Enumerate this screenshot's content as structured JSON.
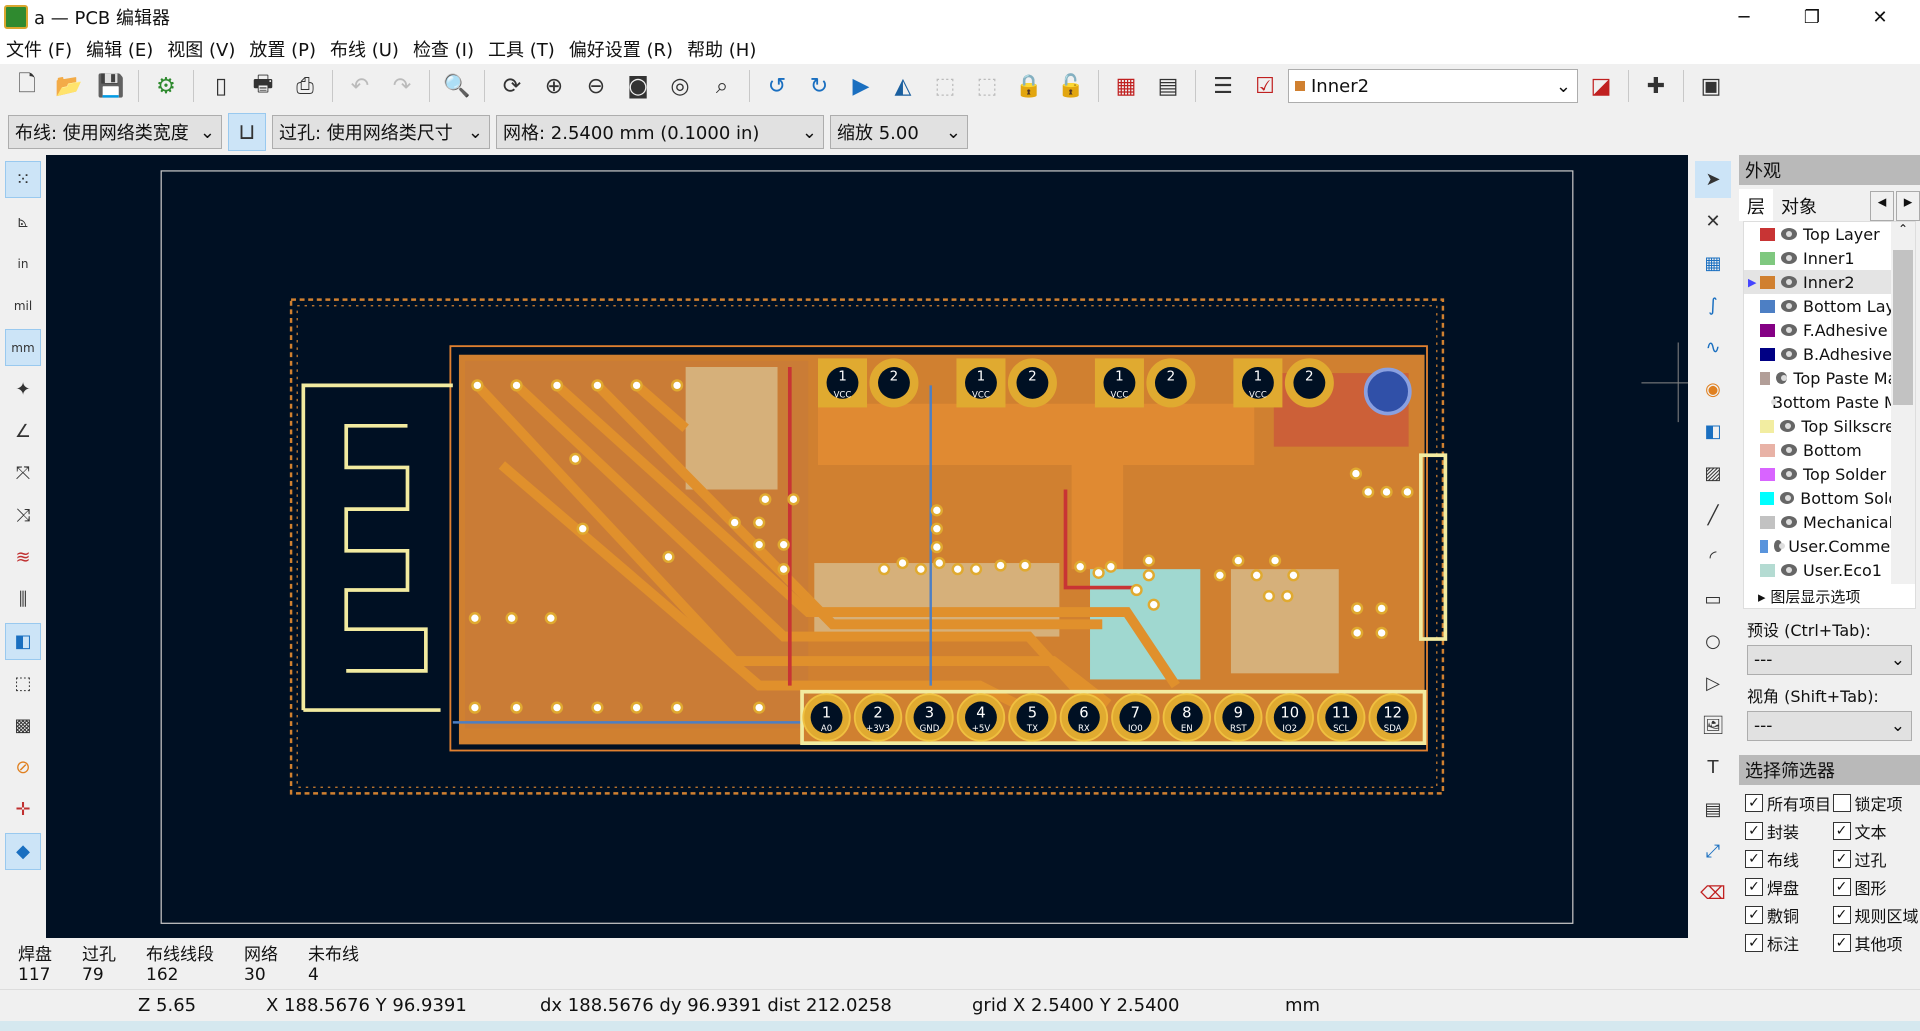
{
  "window": {
    "title": "a — PCB 编辑器",
    "minimize": "─",
    "maximize": "❐",
    "close": "✕"
  },
  "menu": [
    "文件 (F)",
    "编辑 (E)",
    "视图 (V)",
    "放置 (P)",
    "布线 (U)",
    "检查 (I)",
    "工具 (T)",
    "偏好设置 (R)",
    "帮助 (H)"
  ],
  "toolbar": {
    "active_layer": "Inner2",
    "active_layer_color": "#d08030"
  },
  "toolbar2": {
    "track": "布线: 使用网络类宽度",
    "via": "过孔: 使用网络类尺寸",
    "grid": "网格: 2.5400 mm (0.1000 in)",
    "zoom": "缩放 5.00"
  },
  "pcb": {
    "top_headers": [
      {
        "pins": [
          "1",
          "2"
        ],
        "label": "VCC"
      },
      {
        "pins": [
          "1",
          "2"
        ],
        "label": "VCC"
      },
      {
        "pins": [
          "1",
          "2"
        ],
        "label": "VCC"
      },
      {
        "pins": [
          "1",
          "2"
        ],
        "label": "VCC"
      }
    ],
    "bottom_pins": [
      {
        "n": "1",
        "name": "A0"
      },
      {
        "n": "2",
        "name": "+3V3"
      },
      {
        "n": "3",
        "name": "GND"
      },
      {
        "n": "4",
        "name": "+5V"
      },
      {
        "n": "5",
        "name": "TX"
      },
      {
        "n": "6",
        "name": "RX"
      },
      {
        "n": "7",
        "name": "IO0"
      },
      {
        "n": "8",
        "name": "EN"
      },
      {
        "n": "9",
        "name": "RST"
      },
      {
        "n": "10",
        "name": "IO2"
      },
      {
        "n": "11",
        "name": "SCL"
      },
      {
        "n": "12",
        "name": "SDA"
      }
    ],
    "colors": {
      "background": "#001023",
      "copper": "#d08030",
      "silk": "#f2eba0",
      "pad": "#e0aa30"
    }
  },
  "panel": {
    "title": "外观",
    "tab_layers": "层",
    "tab_objects": "对象",
    "layers": [
      {
        "name": "Top Layer",
        "color": "#c83434"
      },
      {
        "name": "Inner1",
        "color": "#7fc87f"
      },
      {
        "name": "Inner2",
        "color": "#d08030",
        "selected": true
      },
      {
        "name": "Bottom Layer",
        "color": "#4d7fc4"
      },
      {
        "name": "F.Adhesive",
        "color": "#840084"
      },
      {
        "name": "B.Adhesive",
        "color": "#000084"
      },
      {
        "name": "Top Paste Mask",
        "color": "#b29e98"
      },
      {
        "name": "Bottom Paste Mask",
        "color": "#00c2c2"
      },
      {
        "name": "Top Silkscreen",
        "color": "#f2eda1"
      },
      {
        "name": "Bottom",
        "color": "#e8b2a6"
      },
      {
        "name": "Top Solder",
        "color": "#d864ff"
      },
      {
        "name": "Bottom Solder",
        "color": "#00ffff"
      },
      {
        "name": "Mechanical",
        "color": "#c2c2c2"
      },
      {
        "name": "User.Comments",
        "color": "#5994dc"
      },
      {
        "name": "User.Eco1",
        "color": "#b4dbd2"
      }
    ],
    "layer_display_options": "图层显示选项",
    "preset_label": "预设 (Ctrl+Tab):",
    "preset_value": "---",
    "viewport_label": "视角 (Shift+Tab):",
    "viewport_value": "---",
    "filter_title": "选择筛选器",
    "filters": [
      {
        "label": "所有项目",
        "checked": true
      },
      {
        "label": "锁定项",
        "checked": false
      },
      {
        "label": "封装",
        "checked": true
      },
      {
        "label": "文本",
        "checked": true
      },
      {
        "label": "布线",
        "checked": true
      },
      {
        "label": "过孔",
        "checked": true
      },
      {
        "label": "焊盘",
        "checked": true
      },
      {
        "label": "图形",
        "checked": true
      },
      {
        "label": "敷铜",
        "checked": true
      },
      {
        "label": "规则区域",
        "checked": true
      },
      {
        "label": "标注",
        "checked": true
      },
      {
        "label": "其他项",
        "checked": true
      }
    ]
  },
  "stats": [
    {
      "label": "焊盘",
      "value": "117"
    },
    {
      "label": "过孔",
      "value": "79"
    },
    {
      "label": "布线线段",
      "value": "162"
    },
    {
      "label": "网络",
      "value": "30"
    },
    {
      "label": "未布线",
      "value": "4"
    }
  ],
  "status": {
    "zoom": "Z 5.65",
    "xy": "X 188.5676  Y 96.9391",
    "delta": "dx 188.5676  dy 96.9391  dist 212.0258",
    "grid": "grid X 2.5400  Y 2.5400",
    "units": "mm"
  }
}
